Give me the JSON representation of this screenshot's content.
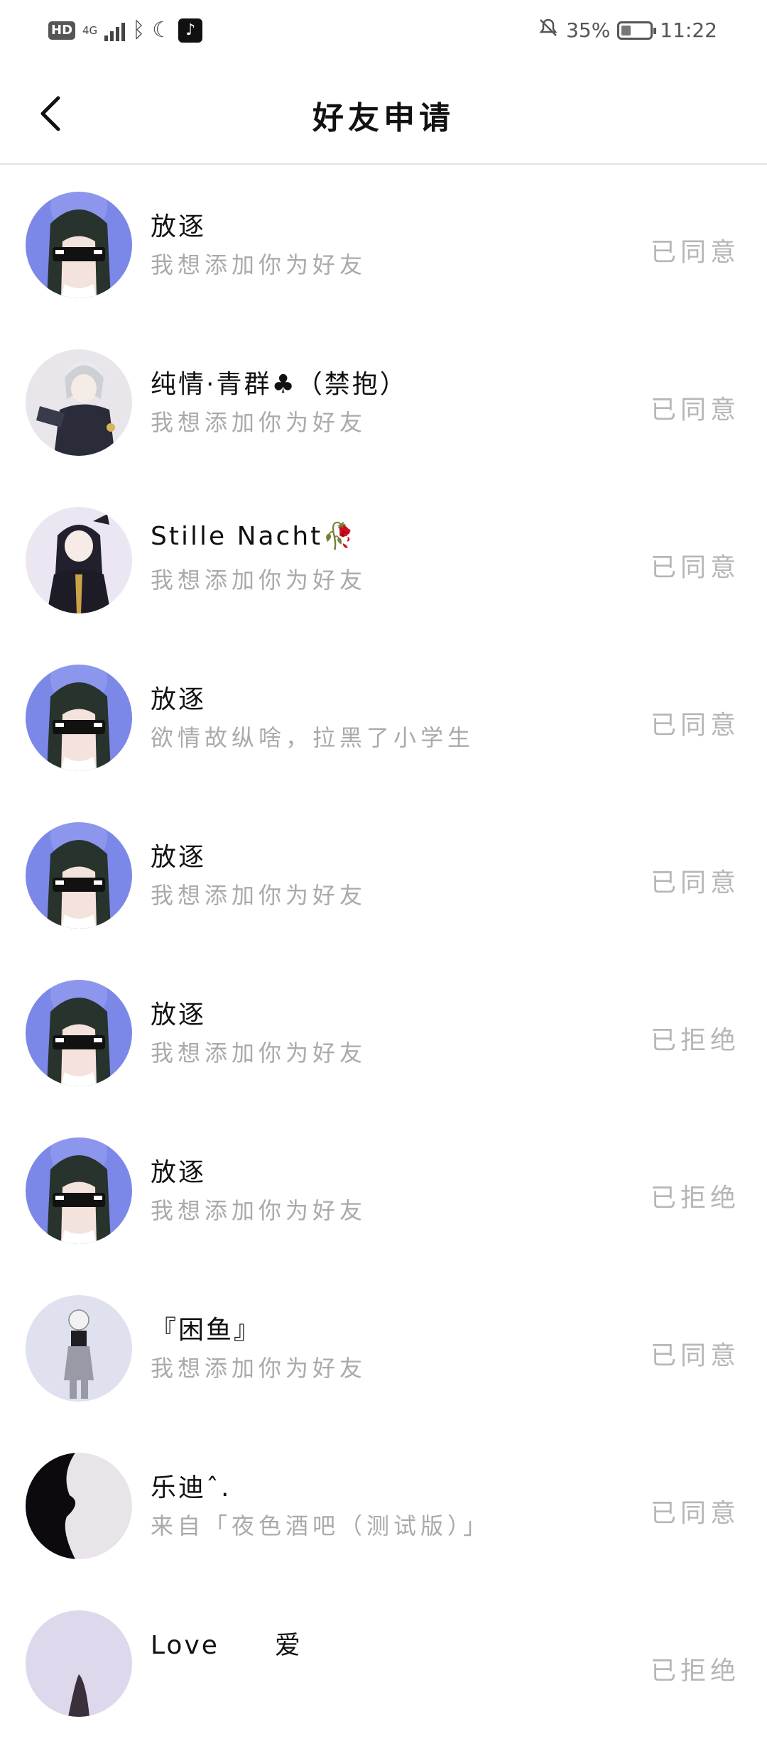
{
  "status_bar": {
    "hd": "HD",
    "network": "4G",
    "battery_percent": "35%",
    "time": "11:22",
    "battery_level": 0.35,
    "icons": [
      "signal-icon",
      "bluetooth-icon",
      "moon-icon",
      "tiktok-icon",
      "mute-icon",
      "battery-icon"
    ]
  },
  "header": {
    "title": "好友申请",
    "back_icon": "chevron-left-icon"
  },
  "requests": [
    {
      "name": "放逐",
      "message": "我想添加你为好友",
      "status": "已同意",
      "avatar": "blue-anime-sunglasses"
    },
    {
      "name": "纯情·青群♣（禁抱）",
      "message": "我想添加你为好友",
      "status": "已同意",
      "avatar": "white-hair-anime"
    },
    {
      "name": "Stille Nacht🥀",
      "message": "我想添加你为好友",
      "status": "已同意",
      "avatar": "dark-hair-anime"
    },
    {
      "name": "放逐",
      "message": "欲情故纵啥，拉黑了小学生",
      "status": "已同意",
      "avatar": "blue-anime-sunglasses"
    },
    {
      "name": "放逐",
      "message": "我想添加你为好友",
      "status": "已同意",
      "avatar": "blue-anime-sunglasses"
    },
    {
      "name": "放逐",
      "message": "我想添加你为好友",
      "status": "已拒绝",
      "avatar": "blue-anime-sunglasses"
    },
    {
      "name": "放逐",
      "message": "我想添加你为好友",
      "status": "已拒绝",
      "avatar": "blue-anime-sunglasses"
    },
    {
      "name": "『困鱼』",
      "message": "我想添加你为好友",
      "status": "已同意",
      "avatar": "gray-anime-figure"
    },
    {
      "name": "乐迪ˆ.",
      "message": "来自「夜色酒吧（测试版）」",
      "status": "已同意",
      "avatar": "silhouette"
    },
    {
      "name": "Love　　爱",
      "message": "",
      "status": "已拒绝",
      "avatar": "lavender-figure"
    }
  ]
}
